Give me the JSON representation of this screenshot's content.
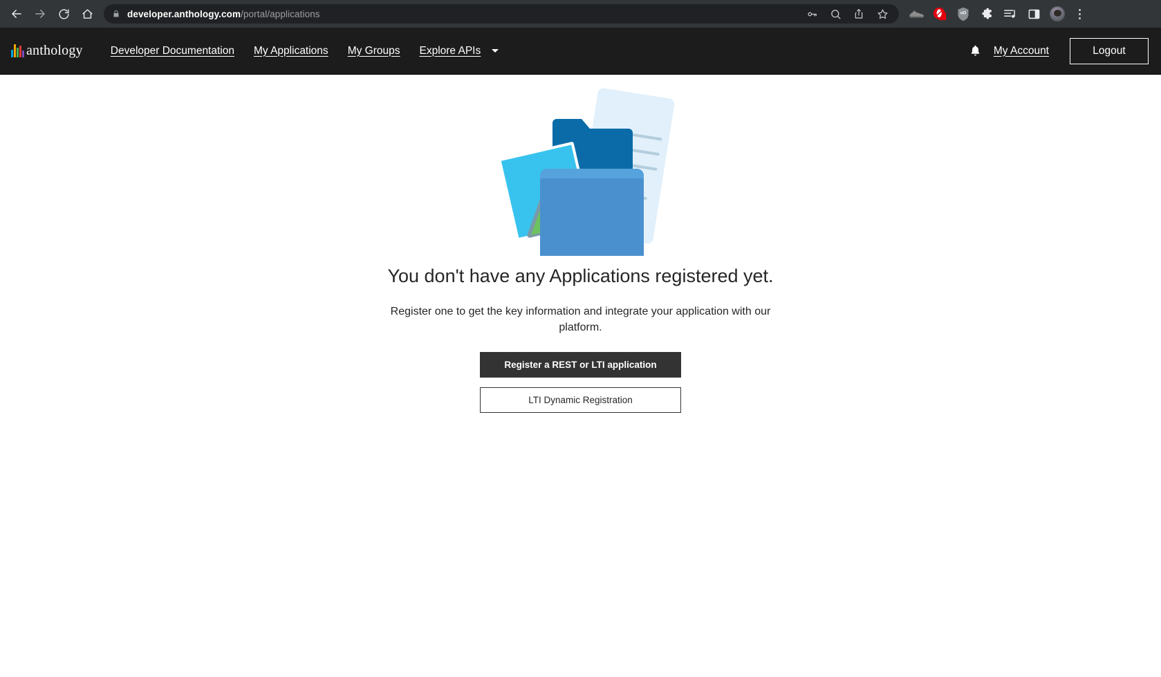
{
  "browser": {
    "back_icon": "back-arrow-icon",
    "forward_icon": "forward-arrow-icon",
    "reload_icon": "reload-icon",
    "home_icon": "home-icon",
    "lock_icon": "lock-icon",
    "url_host": "developer.anthology.com",
    "url_path": "/portal/applications",
    "omnibox_icons": [
      "password-key-icon",
      "search-icon",
      "share-icon",
      "bookmark-star-icon"
    ],
    "extension_icons": [
      "sneaker-extension-icon",
      "opera-red-extension-icon",
      "ublock-shield-icon",
      "extensions-puzzle-icon",
      "reading-list-icon",
      "side-panel-icon"
    ],
    "avatar_icon": "profile-avatar-icon",
    "menu_icon": "chrome-menu-icon"
  },
  "header": {
    "brand_name": "anthology",
    "brand_bar_colors": [
      "#00a3e0",
      "#f2a900",
      "#4caf50",
      "#e03c31",
      "#7a4bc0"
    ],
    "nav_items": [
      {
        "label": "Developer Documentation",
        "name": "nav-developer-documentation"
      },
      {
        "label": "My Applications",
        "name": "nav-my-applications"
      },
      {
        "label": "My Groups",
        "name": "nav-my-groups"
      }
    ],
    "explore_apis_label": "Explore APIs",
    "notifications_icon": "bell-icon",
    "my_account_label": "My Account",
    "logout_label": "Logout"
  },
  "main": {
    "illustration_name": "empty-folder-documents-illustration",
    "title": "You don't have any Applications registered yet.",
    "subtitle": "Register one to get the key information and integrate your application with our platform.",
    "primary_button": "Register a REST or LTI application",
    "secondary_button": "LTI Dynamic Registration"
  },
  "colors": {
    "chrome_bg": "#323639",
    "omnibox_bg": "#202124",
    "site_header_bg": "#1c1c1c",
    "primary_button_bg": "#333333",
    "page_bg": "#ffffff",
    "text": "#262626"
  }
}
